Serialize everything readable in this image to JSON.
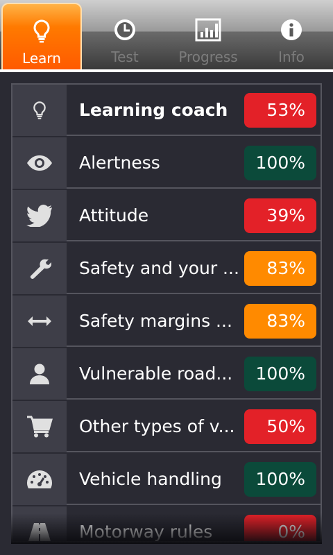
{
  "tabs": [
    {
      "label": "Learn",
      "icon": "bulb-icon",
      "active": true
    },
    {
      "label": "Test",
      "icon": "clock-icon",
      "active": false
    },
    {
      "label": "Progress",
      "icon": "bar-chart-icon",
      "active": false
    },
    {
      "label": "Info",
      "icon": "info-icon",
      "active": false
    }
  ],
  "colors": {
    "red": "#e32128",
    "green": "#0b4a3a",
    "orange": "#ff8a00",
    "accent": "#ff6a00"
  },
  "topics": [
    {
      "label": "Learning coach",
      "value": "53%",
      "status": "red",
      "icon": "bulb-icon",
      "bold": true
    },
    {
      "label": "Alertness",
      "value": "100%",
      "status": "green",
      "icon": "eye-icon"
    },
    {
      "label": "Attitude",
      "value": "39%",
      "status": "red",
      "icon": "bird-icon"
    },
    {
      "label": "Safety and your ...",
      "value": "83%",
      "status": "orange",
      "icon": "wrench-icon"
    },
    {
      "label": "Safety margins ...",
      "value": "83%",
      "status": "orange",
      "icon": "double-arrow-icon"
    },
    {
      "label": "Vulnerable road...",
      "value": "100%",
      "status": "green",
      "icon": "person-icon"
    },
    {
      "label": "Other types of v...",
      "value": "50%",
      "status": "red",
      "icon": "cart-icon"
    },
    {
      "label": "Vehicle handling",
      "value": "100%",
      "status": "green",
      "icon": "speedometer-icon"
    },
    {
      "label": "Motorway rules",
      "value": "0%",
      "status": "red",
      "icon": "road-icon"
    }
  ]
}
